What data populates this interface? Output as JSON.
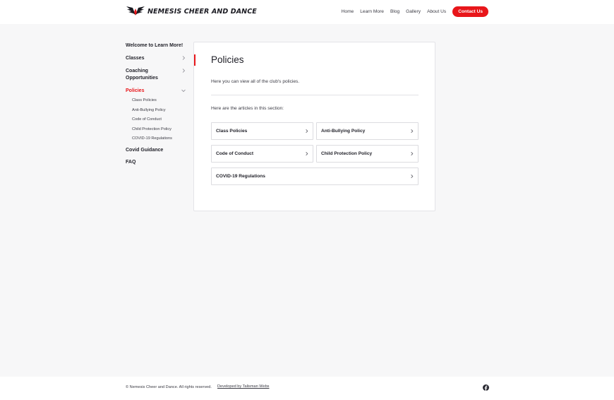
{
  "brand": {
    "name": "Nemesis Cheer and Dance",
    "logo_text": "NEMESIS CHEER AND DANCE",
    "accent": "#e8161a"
  },
  "nav": {
    "items": [
      "Home",
      "Learn More",
      "Blog",
      "Gallery",
      "About Us"
    ],
    "contact_label": "Contact Us"
  },
  "sidebar": {
    "welcome": "Welcome to Learn More!",
    "classes": "Classes",
    "coaching": "Coaching Opportunities",
    "policies": "Policies",
    "sub_items": [
      "Class Policies",
      "Anti-Bullying Policy",
      "Code of Conduct",
      "Child Protection Policy",
      "COVID-19 Regulations"
    ],
    "covid": "Covid Guidance",
    "faq": "FAQ"
  },
  "main": {
    "title": "Policies",
    "intro": "Here you can view all of the club's policies.",
    "articles_intro": "Here are the articles in this section:",
    "articles": [
      "Class Policies",
      "Anti-Bullying Policy",
      "Code of Conduct",
      "Child Protection Policy",
      "COVID-19 Regulations"
    ]
  },
  "footer": {
    "copyright": "© Nemesis Cheer and Dance. All rights reserved.",
    "developer": "Developed by Talisman Webs",
    "social_icon": "facebook-icon"
  }
}
